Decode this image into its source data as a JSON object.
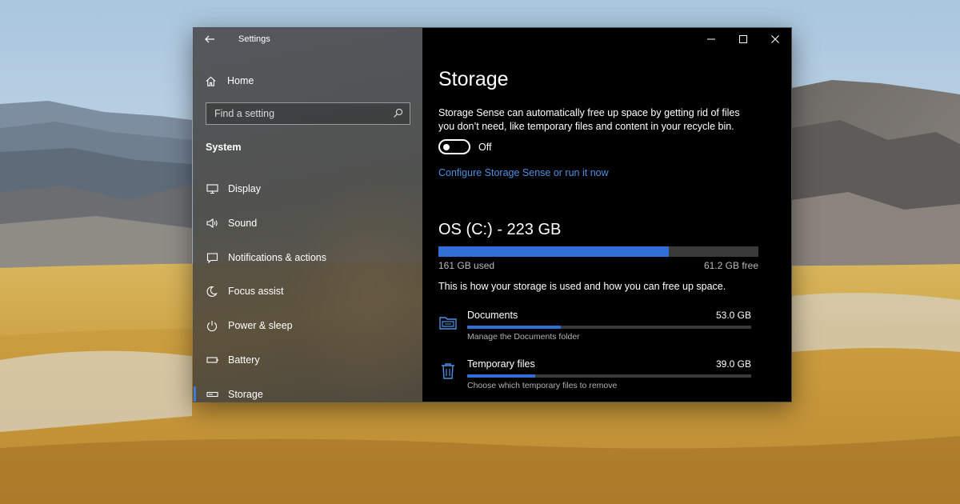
{
  "window": {
    "app_title": "Settings"
  },
  "sidebar": {
    "home_label": "Home",
    "search_placeholder": "Find a setting",
    "section_title": "System",
    "items": [
      {
        "label": "Display",
        "icon": "display-icon"
      },
      {
        "label": "Sound",
        "icon": "sound-icon"
      },
      {
        "label": "Notifications & actions",
        "icon": "notifications-icon"
      },
      {
        "label": "Focus assist",
        "icon": "focus-assist-icon"
      },
      {
        "label": "Power & sleep",
        "icon": "power-icon"
      },
      {
        "label": "Battery",
        "icon": "battery-icon"
      },
      {
        "label": "Storage",
        "icon": "storage-icon",
        "active": true
      }
    ]
  },
  "main": {
    "title": "Storage",
    "description": "Storage Sense can automatically free up space by getting rid of files you don’t need, like temporary files and content in your recycle bin.",
    "toggle_state": "Off",
    "configure_link": "Configure Storage Sense or run it now",
    "drive": {
      "title": "OS (C:) - 223 GB",
      "used": "161 GB used",
      "free": "61.2 GB free",
      "used_fraction": 0.72
    },
    "info_line": "This is how your storage is used and how you can free up space.",
    "categories": [
      {
        "name": "Documents",
        "size": "53.0 GB",
        "subtitle": "Manage the Documents folder",
        "fraction": 0.33,
        "icon": "folder-icon"
      },
      {
        "name": "Temporary files",
        "size": "39.0 GB",
        "subtitle": "Choose which temporary files to remove",
        "fraction": 0.24,
        "icon": "trash-icon"
      }
    ]
  },
  "colors": {
    "accent": "#2f6fd6",
    "link": "#4c8fe4"
  }
}
